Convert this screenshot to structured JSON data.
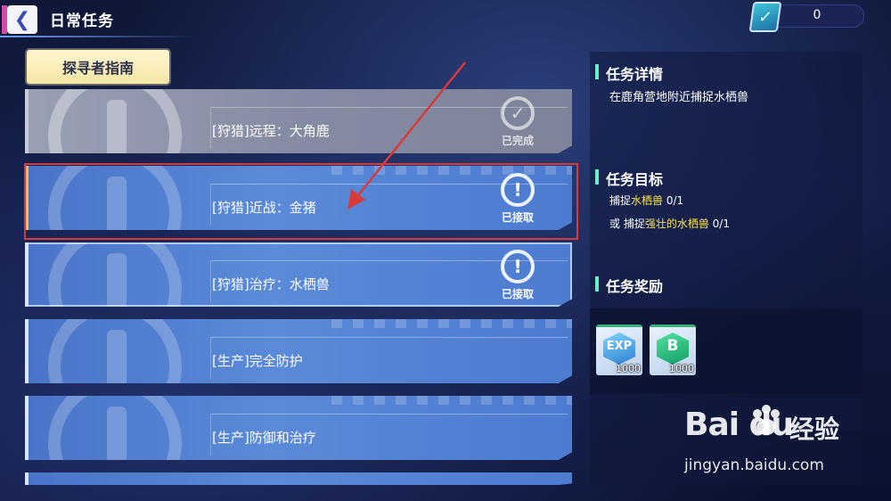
{
  "header": {
    "back_icon": "chevron-left-icon",
    "title": "日常任务",
    "counter_icon": "checklist-icon",
    "counter_value": "0"
  },
  "category": {
    "label": "探寻者指南"
  },
  "quests": [
    {
      "name": "[狩猎]远程：大角鹿",
      "status": "已完成",
      "status_icon": "check-circle-icon",
      "state": "done",
      "emblem": "deer-emblem-icon"
    },
    {
      "name": "[狩猎]近战：金猪",
      "status": "已接取",
      "status_icon": "exclamation-circle-icon",
      "state": "selected",
      "emblem": "deer-emblem-icon"
    },
    {
      "name": "[狩猎]治疗：水栖兽",
      "status": "已接取",
      "status_icon": "exclamation-circle-icon",
      "state": "accepted",
      "emblem": "deer-emblem-icon"
    },
    {
      "name": "[生产]完全防护",
      "status": "",
      "status_icon": "",
      "state": "normal",
      "emblem": "tools-emblem-icon"
    },
    {
      "name": "[生产]防御和治疗",
      "status": "",
      "status_icon": "",
      "state": "normal",
      "emblem": "tools-emblem-icon"
    }
  ],
  "details": {
    "title": "任务详情",
    "text": "在鹿角营地附近捕捉水栖兽"
  },
  "goals": {
    "title": "任务目标",
    "lines": [
      {
        "prefix": "捕捉",
        "target": "水栖兽",
        "progress": " 0/1"
      },
      {
        "prefix": "或 捕捉",
        "target": "强壮的水栖兽",
        "progress": " 0/1"
      }
    ]
  },
  "rewards": {
    "title": "任务奖励",
    "items": [
      {
        "icon": "exp-gem-icon",
        "letter": "EXP",
        "qty": "1000"
      },
      {
        "icon": "b-coin-icon",
        "letter": "B",
        "qty": "1000"
      }
    ]
  },
  "watermark": {
    "brand": "Bai du",
    "cn": "经验",
    "sub": "jingyan.baidu.com"
  },
  "colors": {
    "highlight_text": "#f4e04d",
    "card_blue": "#5a8ad8",
    "annotation_red": "#d83a3a"
  }
}
